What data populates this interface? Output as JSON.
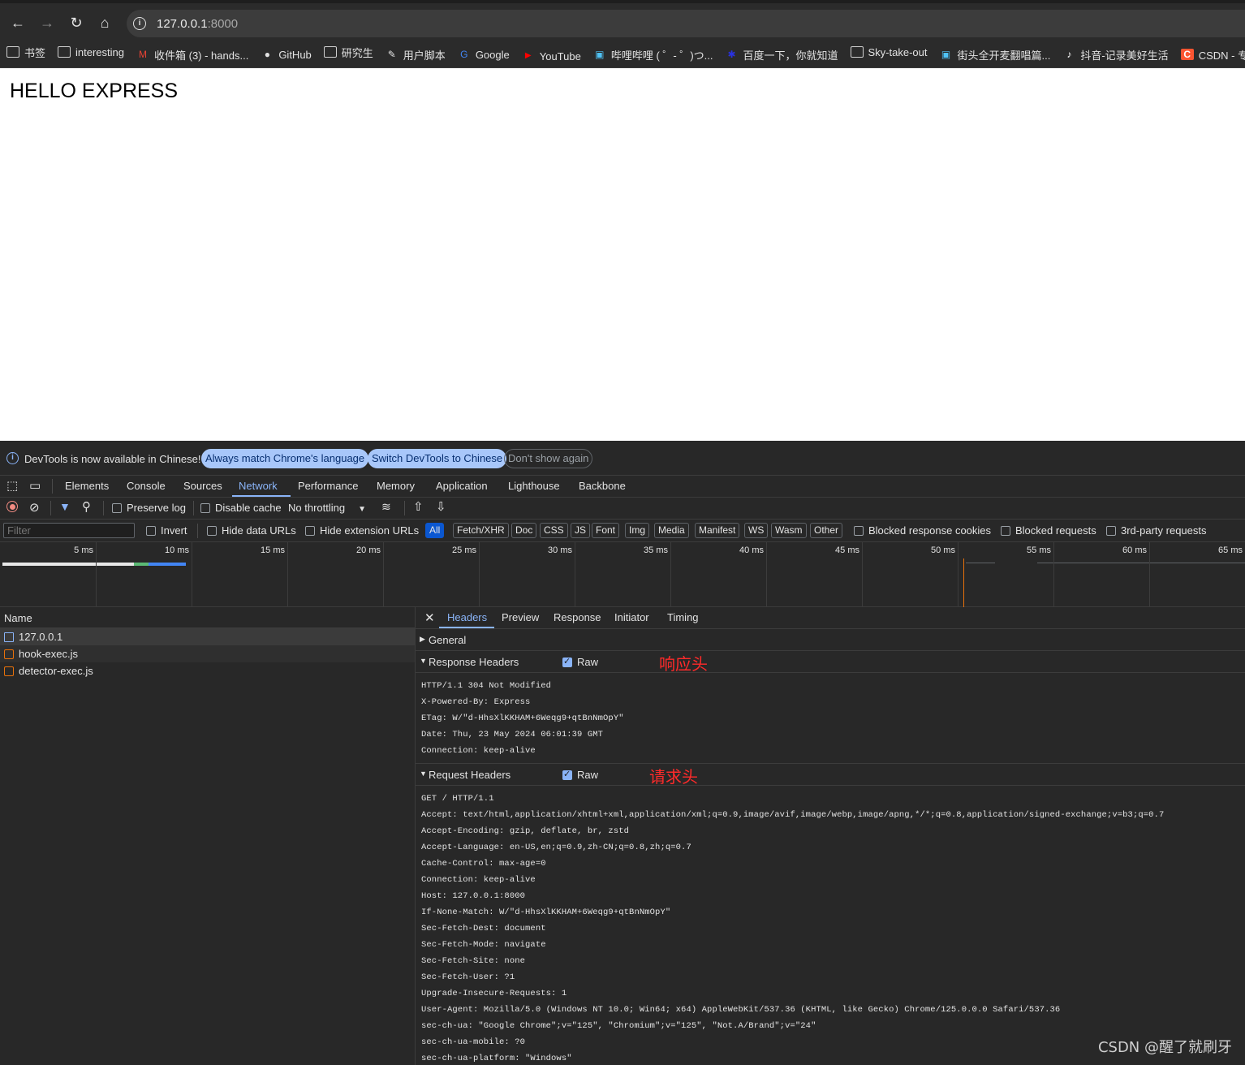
{
  "browser": {
    "url_host": "127.0.0.1",
    "url_port": ":8000",
    "bookmarks": [
      {
        "label": "书签",
        "icon": "folder-icon"
      },
      {
        "label": "interesting",
        "icon": "folder-icon"
      },
      {
        "label": "收件箱 (3) - hands...",
        "icon": "gmail-icon"
      },
      {
        "label": "GitHub",
        "icon": "github-icon"
      },
      {
        "label": "研究生",
        "icon": "folder-icon"
      },
      {
        "label": "用户脚本",
        "icon": "script-icon"
      },
      {
        "label": "Google",
        "icon": "google-icon"
      },
      {
        "label": "YouTube",
        "icon": "youtube-icon"
      },
      {
        "label": "哔哩哔哩 ( ゜- ゜)つ...",
        "icon": "bilibili-icon"
      },
      {
        "label": "百度一下，你就知道",
        "icon": "baidu-icon"
      },
      {
        "label": "Sky-take-out",
        "icon": "folder-icon"
      },
      {
        "label": "街头全开麦翻唱篇...",
        "icon": "bilibili-icon"
      },
      {
        "label": "抖音-记录美好生活",
        "icon": "tiktok-icon"
      },
      {
        "label": "CSDN - 专业开",
        "icon": "csdn-icon"
      }
    ]
  },
  "page": {
    "heading": "HELLO EXPRESS"
  },
  "devtools": {
    "infobar": {
      "message": "DevTools is now available in Chinese!",
      "btn_match": "Always match Chrome's language",
      "btn_switch": "Switch DevTools to Chinese",
      "btn_dismiss": "Don't show again"
    },
    "tabs": [
      "Elements",
      "Console",
      "Sources",
      "Network",
      "Performance",
      "Memory",
      "Application",
      "Lighthouse",
      "Backbone"
    ],
    "active_tab": "Network",
    "toolbar": {
      "preserve_log": "Preserve log",
      "disable_cache": "Disable cache",
      "throttling": "No throttling"
    },
    "filterbar": {
      "placeholder": "Filter",
      "invert": "Invert",
      "hide_data_urls": "Hide data URLs",
      "hide_extension_urls": "Hide extension URLs",
      "types": [
        "All",
        "Fetch/XHR",
        "Doc",
        "CSS",
        "JS",
        "Font",
        "Img",
        "Media",
        "Manifest",
        "WS",
        "Wasm",
        "Other"
      ],
      "blocked_cookies": "Blocked response cookies",
      "blocked_requests": "Blocked requests",
      "third_party": "3rd-party requests"
    },
    "timeline": {
      "ticks": [
        "5 ms",
        "10 ms",
        "15 ms",
        "20 ms",
        "25 ms",
        "30 ms",
        "35 ms",
        "40 ms",
        "45 ms",
        "50 ms",
        "55 ms",
        "60 ms",
        "65 ms"
      ]
    },
    "requests": {
      "header": "Name",
      "items": [
        {
          "name": "127.0.0.1",
          "type": "doc"
        },
        {
          "name": "hook-exec.js",
          "type": "js"
        },
        {
          "name": "detector-exec.js",
          "type": "js"
        }
      ]
    },
    "detail": {
      "tabs": [
        "Headers",
        "Preview",
        "Response",
        "Initiator",
        "Timing"
      ],
      "active_tab": "Headers",
      "general": "General",
      "response_headers_title": "Response Headers",
      "response_annotation": "响应头",
      "raw_label": "Raw",
      "response_headers": [
        "HTTP/1.1 304 Not Modified",
        "X-Powered-By: Express",
        "ETag: W/\"d-HhsXlKKHAM+6Weqg9+qtBnNmOpY\"",
        "Date: Thu, 23 May 2024 06:01:39 GMT",
        "Connection: keep-alive"
      ],
      "request_headers_title": "Request Headers",
      "request_annotation": "请求头",
      "request_headers": [
        "GET / HTTP/1.1",
        "Accept: text/html,application/xhtml+xml,application/xml;q=0.9,image/avif,image/webp,image/apng,*/*;q=0.8,application/signed-exchange;v=b3;q=0.7",
        "Accept-Encoding: gzip, deflate, br, zstd",
        "Accept-Language: en-US,en;q=0.9,zh-CN;q=0.8,zh;q=0.7",
        "Cache-Control: max-age=0",
        "Connection: keep-alive",
        "Host: 127.0.0.1:8000",
        "If-None-Match: W/\"d-HhsXlKKHAM+6Weqg9+qtBnNmOpY\"",
        "Sec-Fetch-Dest: document",
        "Sec-Fetch-Mode: navigate",
        "Sec-Fetch-Site: none",
        "Sec-Fetch-User: ?1",
        "Upgrade-Insecure-Requests: 1",
        "User-Agent: Mozilla/5.0 (Windows NT 10.0; Win64; x64) AppleWebKit/537.36 (KHTML, like Gecko) Chrome/125.0.0.0 Safari/537.36",
        "sec-ch-ua: \"Google Chrome\";v=\"125\", \"Chromium\";v=\"125\", \"Not.A/Brand\";v=\"24\"",
        "sec-ch-ua-mobile: ?0",
        "sec-ch-ua-platform: \"Windows\""
      ]
    }
  },
  "watermark": "CSDN @醒了就刷牙",
  "colors": {
    "accent": "#8ab4f8",
    "annotation": "#ff2a2a",
    "panel_bg": "#282828"
  }
}
